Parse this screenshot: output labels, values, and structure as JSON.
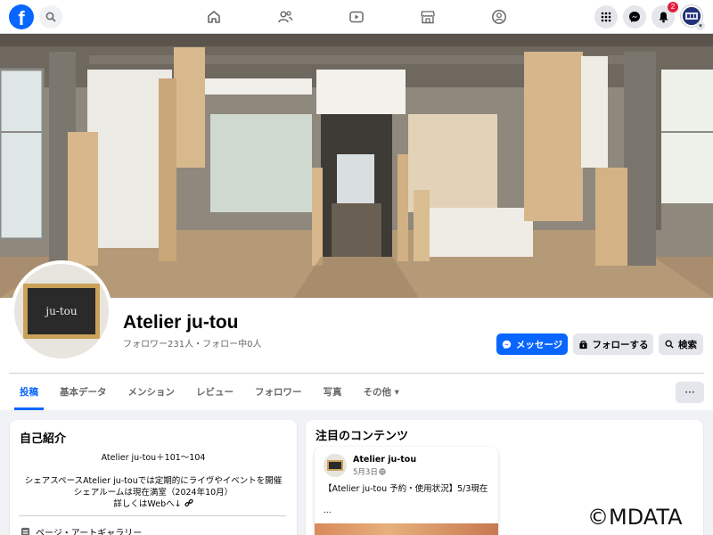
{
  "nav": {
    "logo": "f",
    "notifications_count": "2",
    "account_chevron": "▾"
  },
  "profile": {
    "avatar_sign": "ju-tou",
    "title": "Atelier ju-tou",
    "stats": "フォロワー231人・フォロー中0人"
  },
  "actions": {
    "message": "メッセージ",
    "follow": "フォローする",
    "search": "検索"
  },
  "tabs": [
    {
      "label": "投稿",
      "active": true
    },
    {
      "label": "基本データ"
    },
    {
      "label": "メンション"
    },
    {
      "label": "レビュー"
    },
    {
      "label": "フォロワー"
    },
    {
      "label": "写真"
    },
    {
      "label": "その他 ▾"
    }
  ],
  "more_button": "···",
  "intro": {
    "title": "自己紹介",
    "line1": "Atelier ju-tou＋101〜104",
    "line2": "シェアスペースAtelier ju-touでは定期的にライヴやイベントを開催",
    "line3": "シェアルームは現在満室（2024年10月）",
    "line4": "詳しくはWebへ↓",
    "category": "ページ・アートギャラリー"
  },
  "featured": {
    "title": "注目のコンテンツ",
    "post": {
      "author": "Atelier ju-tou",
      "date": "5月3日",
      "text": "【Atelier ju-tou 予約・使用状況】5/3現在",
      "more": "..."
    }
  },
  "watermark": "©MDATA",
  "colors": {
    "brand": "#0866ff",
    "badge": "#e41e3f",
    "secondary_button": "#e4e6eb",
    "page_bg": "#f0f2f5"
  }
}
